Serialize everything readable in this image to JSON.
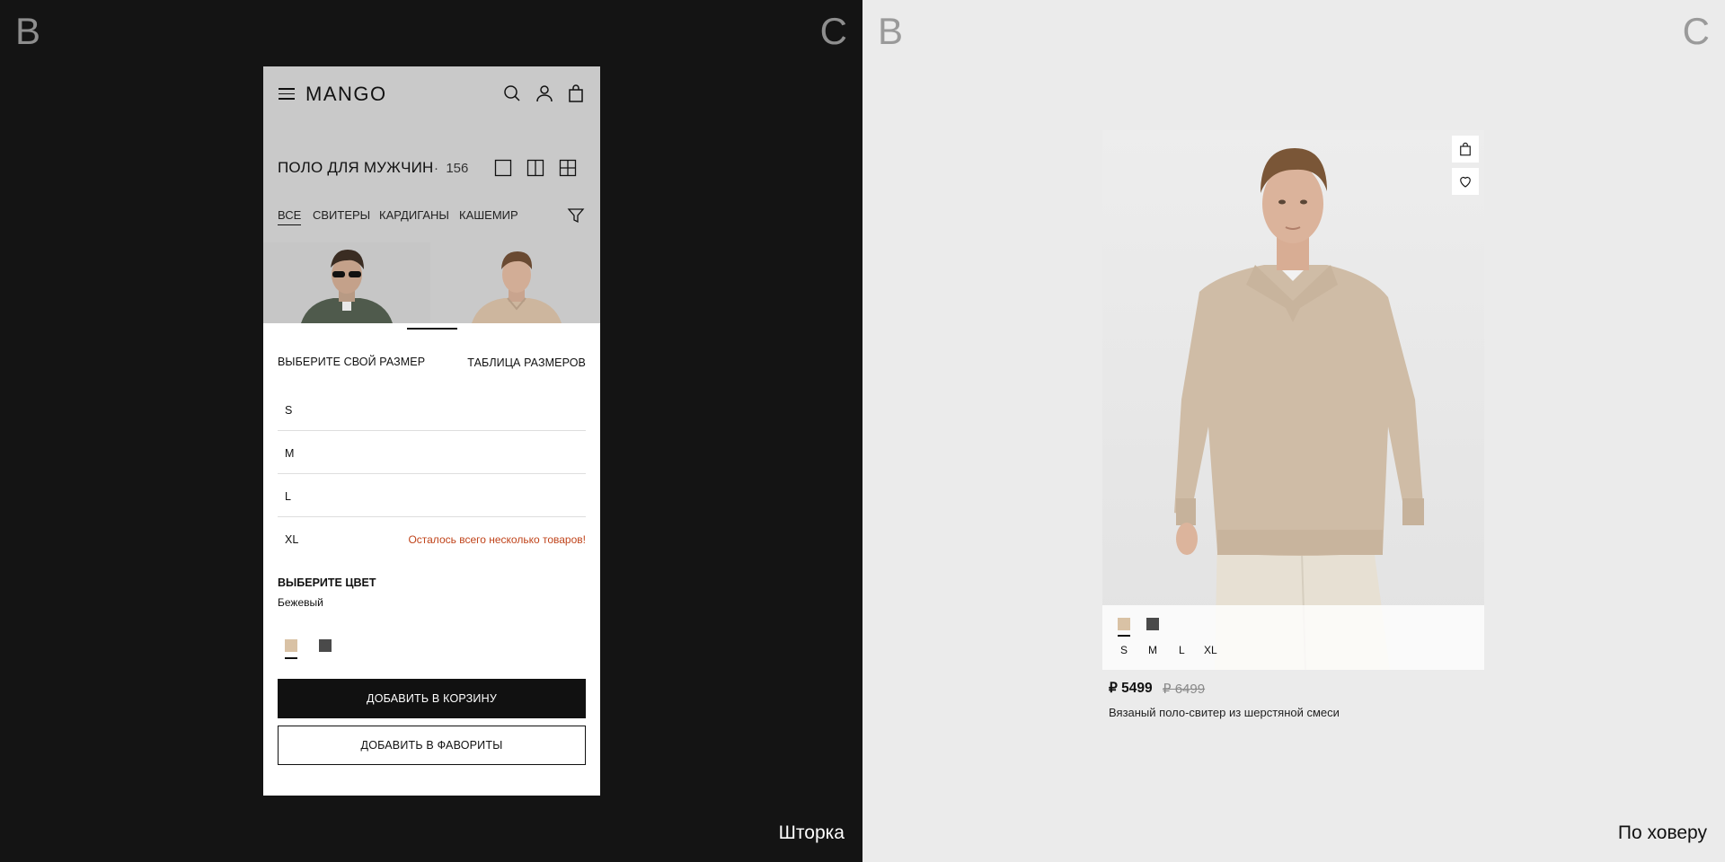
{
  "left_panel": {
    "corner_left": "B",
    "corner_right": "C",
    "caption": "Шторка",
    "phone": {
      "logo": "MANGO",
      "page_title": "ПОЛО ДЛЯ МУЖЧИН",
      "separator": "·",
      "count": "156",
      "categories": [
        {
          "label": "ВСЕ",
          "active": true
        },
        {
          "label": "СВИТЕРЫ",
          "active": false
        },
        {
          "label": "КАРДИГАНЫ",
          "active": false
        },
        {
          "label": "КАШЕМИР",
          "active": false
        }
      ],
      "size_sheet": {
        "title": "ВЫБЕРИТЕ СВОЙ РАЗМЕР",
        "size_table_link": "ТАБЛИЦА РАЗМЕРОВ",
        "sizes": [
          {
            "label": "S",
            "note": ""
          },
          {
            "label": "M",
            "note": ""
          },
          {
            "label": "L",
            "note": ""
          },
          {
            "label": "XL",
            "note": "Осталось всего несколько товаров!"
          }
        ],
        "color_title": "ВЫБЕРИТЕ ЦВЕТ",
        "color_name": "Бежевый",
        "swatches": [
          "#d9c2a5",
          "#4a4a4a"
        ],
        "add_to_cart": "ДОБАВИТЬ В КОРЗИНУ",
        "add_to_favorites": "ДОБАВИТЬ В ФАВОРИТЫ"
      }
    }
  },
  "right_panel": {
    "corner_left": "B",
    "corner_right": "C",
    "caption": "По ховеру",
    "card": {
      "swatches": [
        "#d9c2a5",
        "#4a4a4a"
      ],
      "sizes": [
        "S",
        "M",
        "L",
        "XL"
      ],
      "price": "₽ 5499",
      "old_price": "₽ 6499",
      "name": "Вязаный поло-свитер из шерстяной смеси"
    }
  },
  "colors": {
    "dark_bg": "#141414",
    "light_bg": "#ebebeb",
    "stock_warning": "#c0441b",
    "beige": "#d9c2a5"
  }
}
